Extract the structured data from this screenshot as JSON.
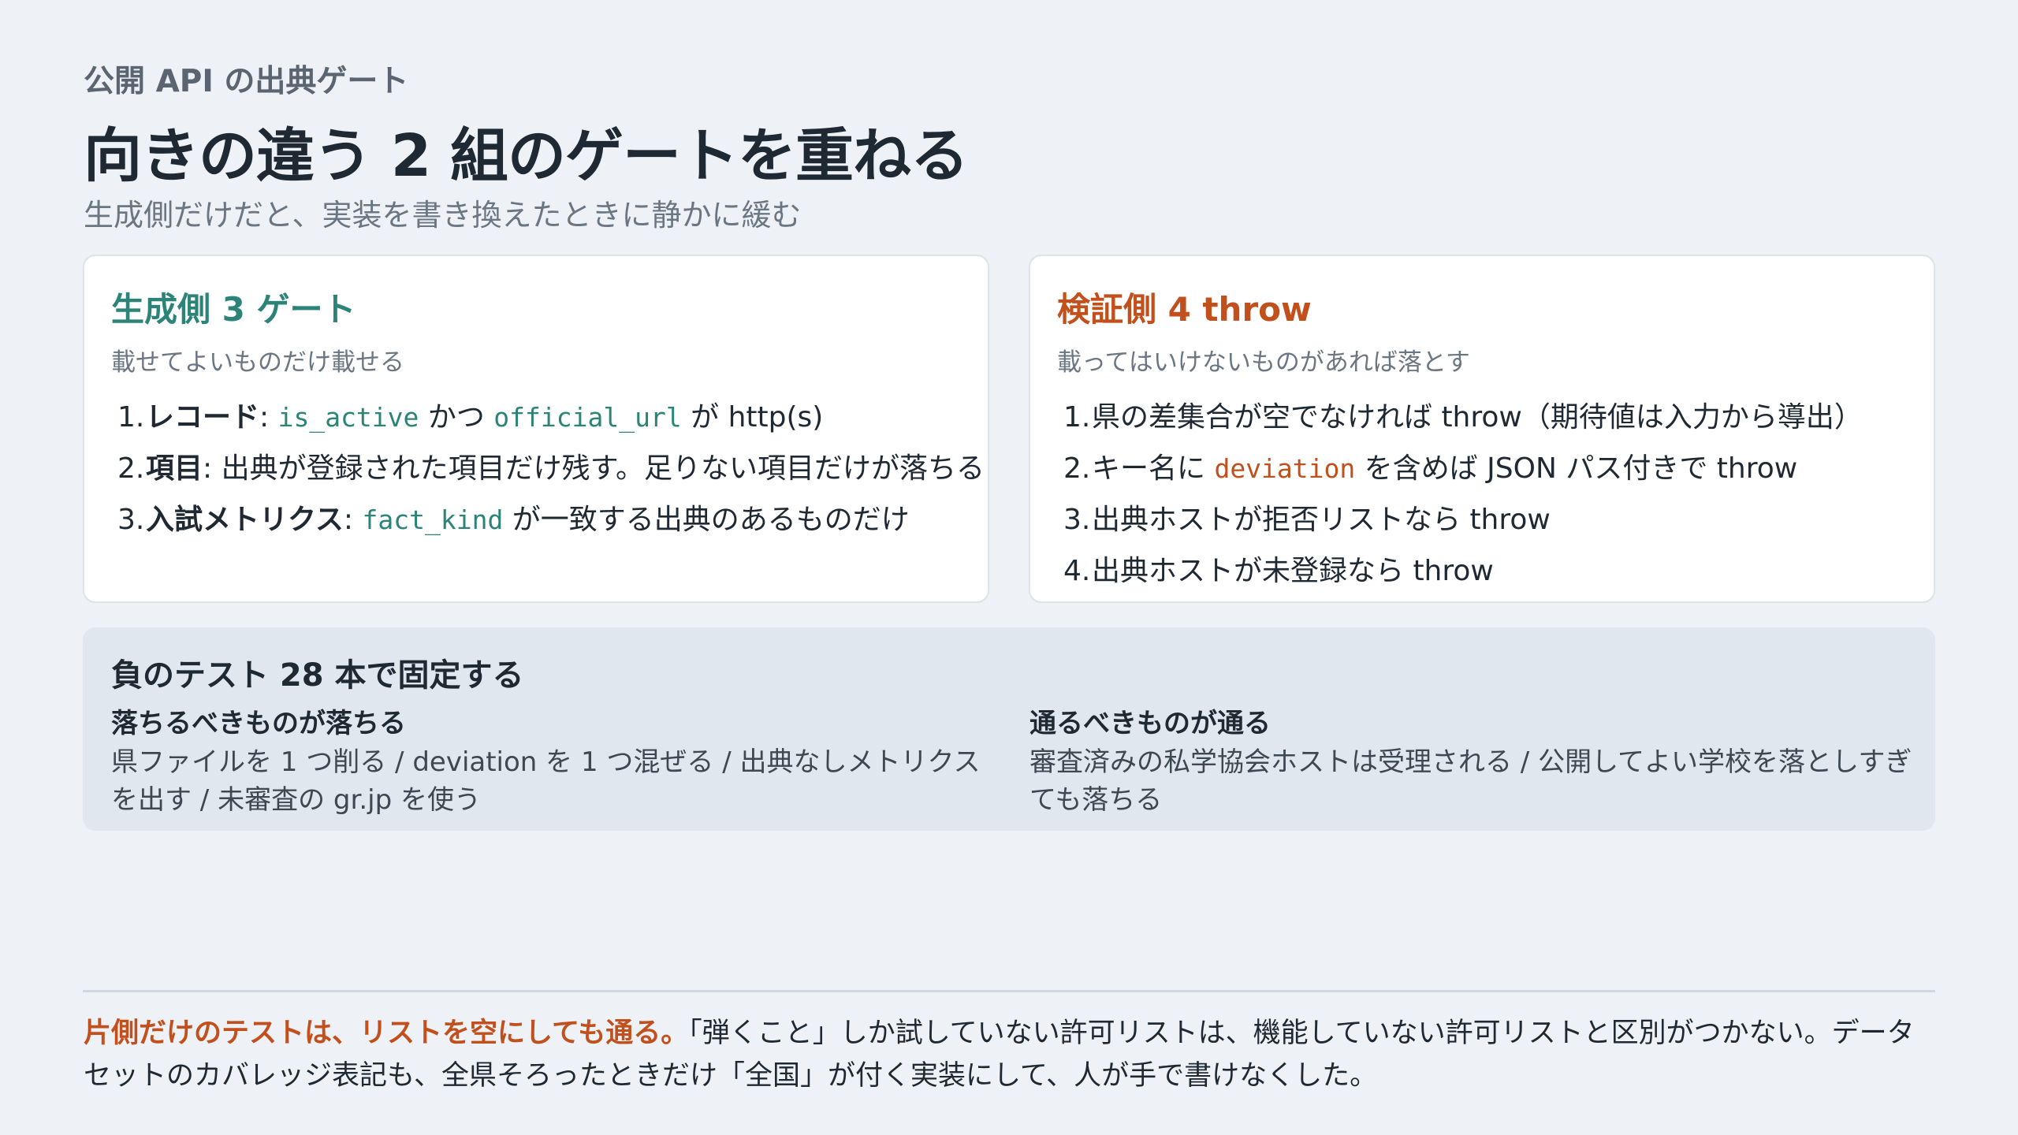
{
  "header": {
    "eyebrow": "公開 API の出典ゲート",
    "title": "向きの違う 2 組のゲートを重ねる",
    "subtitle": "生成側だけだと、実装を書き換えたときに静かに緩む"
  },
  "generation": {
    "heading": "生成側 3 ゲート",
    "lead": "載せてよいものだけ載せる",
    "items": [
      {
        "num": "1.",
        "label": "レコード",
        "sep": ": ",
        "code1": "is_active",
        "mid": " かつ ",
        "code2": "official_url",
        "tail": " が http(s)"
      },
      {
        "num": "2.",
        "label": "項目",
        "sep": ": ",
        "tail": "出典が登録された項目だけ残す。足りない項目だけが落ちる"
      },
      {
        "num": "3.",
        "label": "入試メトリクス",
        "sep": ": ",
        "code1": "fact_kind",
        "tail": " が一致する出典のあるものだけ"
      }
    ]
  },
  "validation": {
    "heading": "検証側 4 throw",
    "lead": "載ってはいけないものがあれば落とす",
    "items": [
      {
        "num": "1.",
        "text": "県の差集合が空でなければ throw（期待値は入力から導出）"
      },
      {
        "num": "2.",
        "pre": "キー名に ",
        "code": "deviation",
        "post": " を含めば JSON パス付きで throw"
      },
      {
        "num": "3.",
        "text": "出典ホストが拒否リストなら throw"
      },
      {
        "num": "4.",
        "text": "出典ホストが未登録なら throw"
      }
    ]
  },
  "tests": {
    "heading": "負のテスト 28 本で固定する",
    "left_heading": "落ちるべきものが落ちる",
    "left_text": "県ファイルを 1 つ削る / deviation を 1 つ混ぜる / 出典なしメトリクスを出す / 未審査の gr.jp を使う",
    "right_heading": "通るべきものが通る",
    "right_text": "審査済みの私学協会ホストは受理される / 公開してよい学校を落としすぎても落ちる"
  },
  "footer": {
    "highlight": "片側だけのテストは、リストを空にしても通る。",
    "text": "「弾くこと」しか試していない許可リストは、機能していない許可リストと区別がつかない。データセットのカバレッジ表記も、全県そろったときだけ「全国」が付く実装にして、人が手で書けなくした。"
  },
  "colors": {
    "background": "#eef1f6",
    "teal_accent": "#2c8478",
    "orange_accent": "#c2501c",
    "panel": "#e1e7ef"
  }
}
